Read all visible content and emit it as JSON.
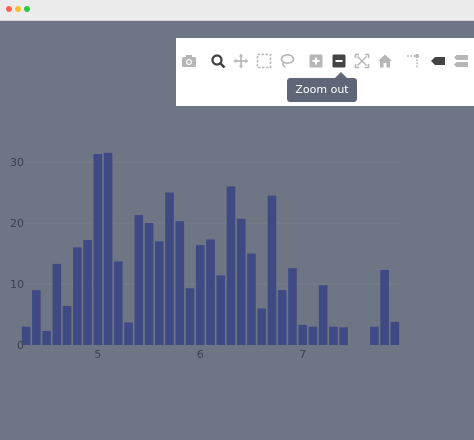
{
  "window": {
    "controls": [
      "close",
      "minimize",
      "zoom"
    ]
  },
  "modebar": {
    "buttons": [
      {
        "icon": "camera-icon",
        "label": "Download plot as a png"
      },
      {
        "icon": "zoom-icon",
        "label": "Zoom",
        "active": true
      },
      {
        "icon": "pan-icon",
        "label": "Pan"
      },
      {
        "icon": "box-select-icon",
        "label": "Box Select"
      },
      {
        "icon": "lasso-select-icon",
        "label": "Lasso Select"
      },
      {
        "icon": "zoom-in-icon",
        "label": "Zoom in"
      },
      {
        "icon": "zoom-out-icon",
        "label": "Zoom out",
        "hovered": true
      },
      {
        "icon": "autoscale-icon",
        "label": "Autoscale"
      },
      {
        "icon": "home-icon",
        "label": "Reset axes"
      },
      {
        "icon": "spike-lines-icon",
        "label": "Toggle Spike Lines"
      },
      {
        "icon": "hover-closest-icon",
        "label": "Show closest data on hover"
      },
      {
        "icon": "hover-compare-icon",
        "label": "Compare data on hover"
      }
    ]
  },
  "tooltip": {
    "text": "Zoom out"
  },
  "colors": {
    "background": "#6e7685",
    "bar": "#3f4a84",
    "modebar_bg": "#ffffff",
    "active_icon": "#444444",
    "inactive_icon": "#b6b6b6"
  },
  "chart_data": {
    "type": "bar",
    "title": "",
    "xlabel": "",
    "ylabel": "",
    "x": [
      4.3,
      4.4,
      4.5,
      4.6,
      4.7,
      4.8,
      4.9,
      5.0,
      5.1,
      5.2,
      5.3,
      5.4,
      5.5,
      5.6,
      5.7,
      5.8,
      5.9,
      6.0,
      6.1,
      6.2,
      6.3,
      6.4,
      6.5,
      6.6,
      6.7,
      6.8,
      6.9,
      7.0,
      7.1,
      7.2,
      7.3,
      7.4,
      7.5,
      7.6,
      7.7,
      7.8,
      7.9
    ],
    "values": [
      3,
      9,
      2.3,
      13.3,
      6.4,
      16,
      17.2,
      31.3,
      31.5,
      13.7,
      3.7,
      21.3,
      20,
      17,
      25,
      20.3,
      9.3,
      16.4,
      17.3,
      11.4,
      26,
      20.7,
      15,
      6,
      24.5,
      9,
      12.6,
      3.3,
      3,
      9.8,
      3,
      2.9,
      0,
      0,
      3,
      12.3,
      3.8
    ],
    "xticks": [
      5,
      6,
      7
    ],
    "yticks": [
      0,
      10,
      20,
      30
    ],
    "xlim": [
      4.25,
      7.95
    ],
    "ylim": [
      0,
      34
    ],
    "grid": true,
    "legend": "none"
  }
}
